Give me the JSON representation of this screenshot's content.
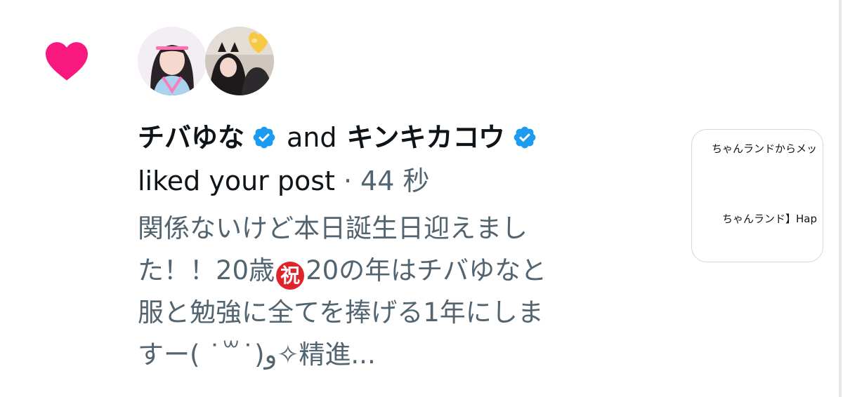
{
  "notification": {
    "type_icon": "heart-icon",
    "heart_color": "#f91880",
    "verified_color": "#1d9bf0",
    "users": [
      {
        "name": "チバゆな",
        "verified": true
      },
      {
        "name": "キンキカコウ",
        "verified": true
      }
    ],
    "conjunction": "and",
    "action": "liked your post",
    "separator": "·",
    "time": "44 秒",
    "post_lines": [
      "関係ないけど本日誕生日迎えまし",
      "た！！20歳",
      "20の年はチバゆなと",
      "服と勉強に全てを捧げる1年にしま",
      "すー( ˙꒳˙)و✧精進..."
    ],
    "celebration_emoji": "祝",
    "preview": {
      "line1": "ちゃんランドからメッ",
      "line2": "ちゃんランド】Hap"
    }
  }
}
